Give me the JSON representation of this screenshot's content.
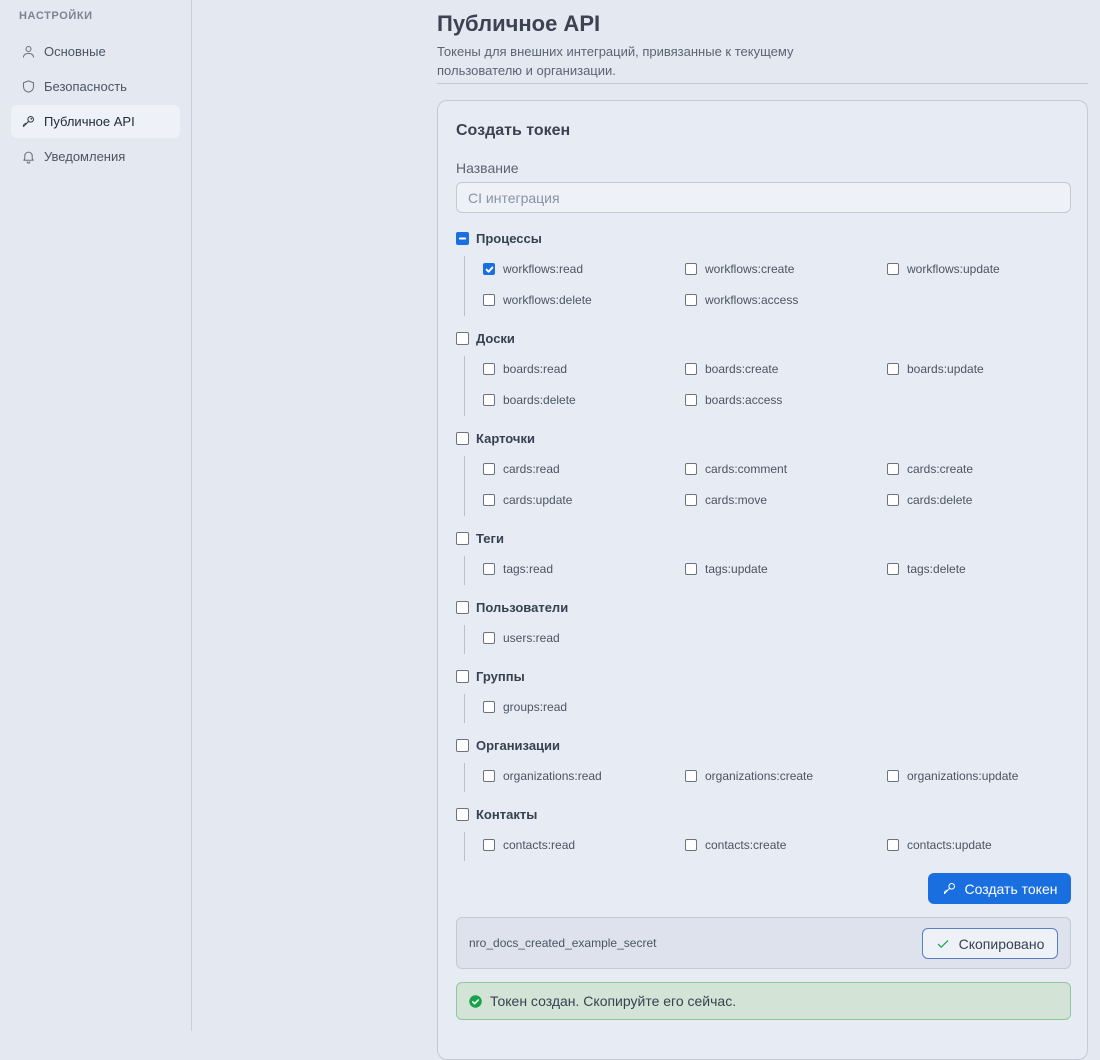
{
  "sidebar": {
    "heading": "НАСТРОЙКИ",
    "items": [
      {
        "label": "Основные",
        "icon": "user-icon",
        "active": false
      },
      {
        "label": "Безопасность",
        "icon": "shield-icon",
        "active": false
      },
      {
        "label": "Публичное API",
        "icon": "key-icon",
        "active": true
      },
      {
        "label": "Уведомления",
        "icon": "bell-icon",
        "active": false
      }
    ]
  },
  "header": {
    "title": "Публичное API",
    "subtitle": "Токены для внешних интеграций, привязанные к текущему пользователю и организации."
  },
  "form": {
    "title": "Создать токен",
    "name_label": "Название",
    "name_placeholder": "CI интеграция",
    "name_value": "",
    "groups": [
      {
        "label": "Процессы",
        "state": "mixed",
        "perms": [
          {
            "label": "workflows:read",
            "checked": true
          },
          {
            "label": "workflows:create",
            "checked": false
          },
          {
            "label": "workflows:update",
            "checked": false
          },
          {
            "label": "workflows:delete",
            "checked": false
          },
          {
            "label": "workflows:access",
            "checked": false
          }
        ]
      },
      {
        "label": "Доски",
        "state": "unchecked",
        "perms": [
          {
            "label": "boards:read",
            "checked": false
          },
          {
            "label": "boards:create",
            "checked": false
          },
          {
            "label": "boards:update",
            "checked": false
          },
          {
            "label": "boards:delete",
            "checked": false
          },
          {
            "label": "boards:access",
            "checked": false
          }
        ]
      },
      {
        "label": "Карточки",
        "state": "unchecked",
        "perms": [
          {
            "label": "cards:read",
            "checked": false
          },
          {
            "label": "cards:comment",
            "checked": false
          },
          {
            "label": "cards:create",
            "checked": false
          },
          {
            "label": "cards:update",
            "checked": false
          },
          {
            "label": "cards:move",
            "checked": false
          },
          {
            "label": "cards:delete",
            "checked": false
          }
        ]
      },
      {
        "label": "Теги",
        "state": "unchecked",
        "perms": [
          {
            "label": "tags:read",
            "checked": false
          },
          {
            "label": "tags:update",
            "checked": false
          },
          {
            "label": "tags:delete",
            "checked": false
          }
        ]
      },
      {
        "label": "Пользователи",
        "state": "unchecked",
        "perms": [
          {
            "label": "users:read",
            "checked": false
          }
        ]
      },
      {
        "label": "Группы",
        "state": "unchecked",
        "perms": [
          {
            "label": "groups:read",
            "checked": false
          }
        ]
      },
      {
        "label": "Организации",
        "state": "unchecked",
        "perms": [
          {
            "label": "organizations:read",
            "checked": false
          },
          {
            "label": "organizations:create",
            "checked": false
          },
          {
            "label": "organizations:update",
            "checked": false
          }
        ]
      },
      {
        "label": "Контакты",
        "state": "unchecked",
        "perms": [
          {
            "label": "contacts:read",
            "checked": false
          },
          {
            "label": "contacts:create",
            "checked": false
          },
          {
            "label": "contacts:update",
            "checked": false
          }
        ]
      }
    ],
    "create_label": "Создать токен",
    "token_value": "nro_docs_created_example_secret",
    "copy_label": "Скопировано",
    "success_message": "Токен создан. Скопируйте его сейчас."
  },
  "colors": {
    "accent": "#1a6fe0",
    "success": "#16a34a"
  }
}
